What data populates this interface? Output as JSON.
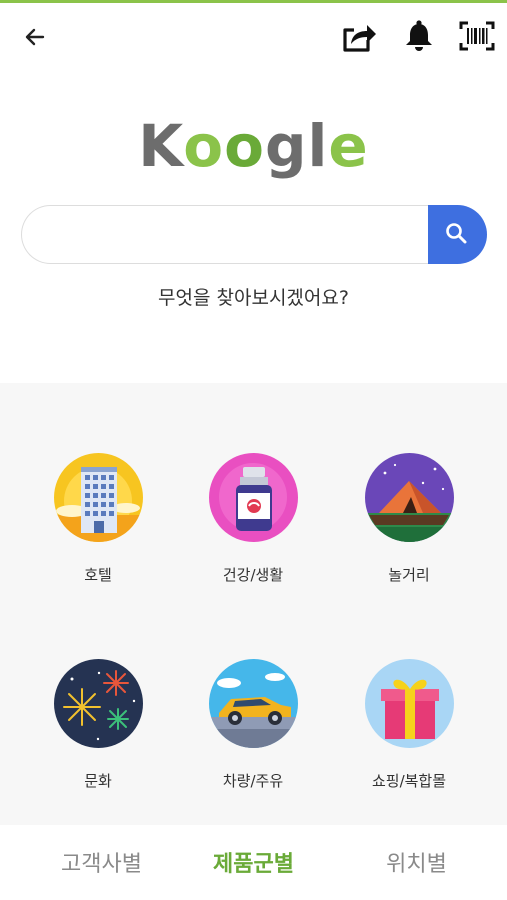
{
  "header": {
    "back_icon": "back-arrow-icon",
    "share_icon": "share-icon",
    "bell_icon": "bell-icon",
    "barcode_icon": "barcode-icon"
  },
  "logo": {
    "letters": [
      "K",
      "o",
      "o",
      "g",
      "l",
      "e"
    ],
    "colors": [
      "#6d6d6d",
      "#8bc34a",
      "#6aaa38",
      "#6d6d6d",
      "#6d6d6d",
      "#8bc34a"
    ]
  },
  "search": {
    "value": "",
    "placeholder": "",
    "button_color": "#3e6fe0",
    "prompt": "무엇을 찾아보시겠어요?"
  },
  "categories": [
    {
      "label": "호텔",
      "icon": "hotel-icon"
    },
    {
      "label": "건강/생활",
      "icon": "health-bottle-icon"
    },
    {
      "label": "놀거리",
      "icon": "tent-icon"
    },
    {
      "label": "문화",
      "icon": "fireworks-icon"
    },
    {
      "label": "차량/주유",
      "icon": "car-icon"
    },
    {
      "label": "쇼핑/복합몰",
      "icon": "gift-icon"
    }
  ],
  "tabs": [
    {
      "label": "고객사별",
      "active": false
    },
    {
      "label": "제품군별",
      "active": true
    },
    {
      "label": "위치별",
      "active": false
    }
  ],
  "colors": {
    "accent_green": "#6aaa38",
    "inactive_tab": "#8a8a8a"
  }
}
